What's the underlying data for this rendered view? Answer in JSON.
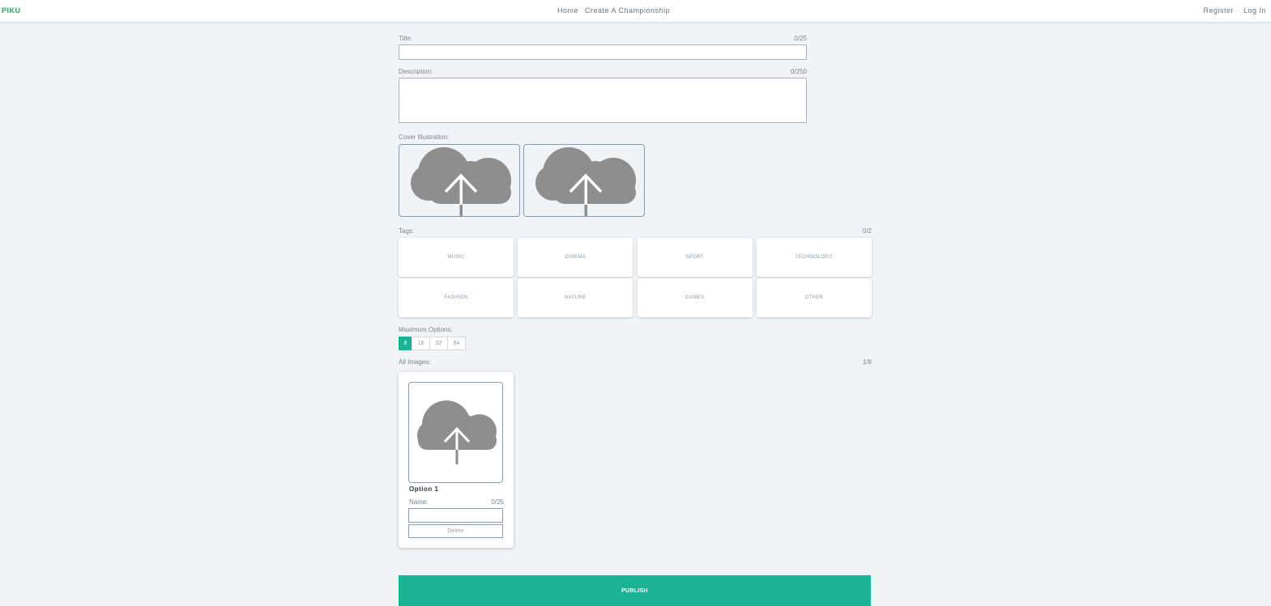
{
  "nav": {
    "brand": "PIKU",
    "center_links": [
      "Home",
      "Create A Championship"
    ],
    "right_links": [
      "Register",
      "Log In"
    ]
  },
  "form": {
    "title": {
      "label": "Title:",
      "counter": "0/25",
      "value": ""
    },
    "description": {
      "label": "Description:",
      "counter": "0/250",
      "value": ""
    },
    "cover": {
      "label": "Cover Illustration:",
      "icon": "cloud-upload-icon"
    },
    "tags": {
      "label": "Tags:",
      "counter": "0/2",
      "items": [
        "MUSIC",
        "CINEMA",
        "SPORT",
        "TECHNOLOGY",
        "FASHION",
        "NATURE",
        "GAMES",
        "OTHER"
      ]
    },
    "max_options": {
      "label": "Maximum Options:",
      "options": [
        "8",
        "16",
        "32",
        "64"
      ],
      "selected": "8"
    },
    "all_images": {
      "label": "All Images:",
      "counter": "1/8",
      "cards": [
        {
          "title": "Option 1",
          "name_label": "Name:",
          "name_counter": "0/25",
          "delete_label": "Delete"
        }
      ]
    },
    "publish_label": "PUBLISH"
  },
  "colors": {
    "accent": "#1ab394",
    "brand": "#1aaa55",
    "cloud": "#8e8e8e",
    "background": "#f0f4f7"
  }
}
